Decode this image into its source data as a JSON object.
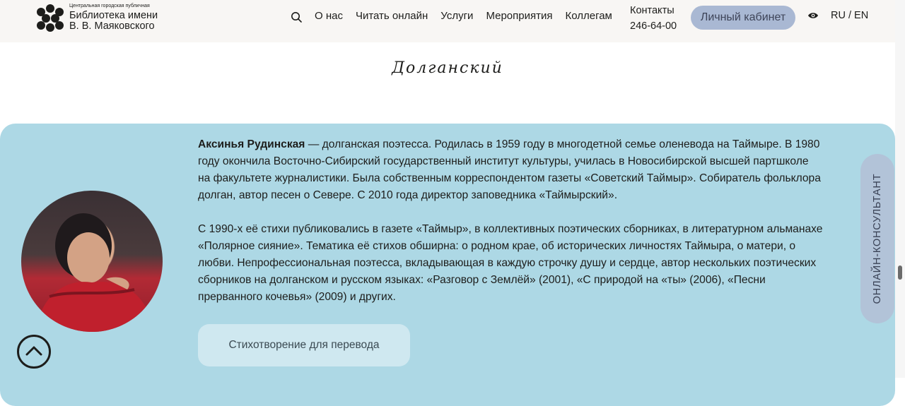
{
  "header": {
    "logo": {
      "small": "Центральная городская публичная",
      "line1": "Библиотека имени",
      "line2": "В. В. Маяковского"
    },
    "nav": [
      "О нас",
      "Читать онлайн",
      "Услуги",
      "Мероприятия",
      "Коллегам"
    ],
    "contacts_label": "Контакты",
    "contacts_phone": "246-64-00",
    "cabinet_label": "Личный кабинет",
    "lang_ru": "RU",
    "lang_sep": " / ",
    "lang_en": "EN"
  },
  "section_title": "Долганский",
  "bio": {
    "name": "Аксинья Рудинская",
    "p1_rest_line1": " — долганская поэтесса. Родилась в 1959 году в многодетной семье оленевода на Таймыре. В 1980",
    "p1_line2": "году окончила Восточно-Сибирский государственный институт культуры, училась в Новосибирской высшей партшколе",
    "p1_line3": "на факультете журналистики. Была собственным корреспондентом газеты «Советский Таймыр». Собиратель фольклора",
    "p1_line4": "долган, автор песен о Севере. С 2010 года директор заповедника «Таймырский».",
    "p2_line1": "С 1990-х её стихи публиковались в газете «Таймыр», в коллективных поэтических сборниках, в литературном альманахе",
    "p2_line2": "«Полярное сияние». Тематика её стихов обширна: о родном крае, об исторических личностях Таймыра, о матери, о",
    "p2_line3": "любви. Непрофессиональная поэтесса, вкладывающая в каждую строчку душу и сердце, автор нескольких поэтических",
    "p2_line4": "сборников на долганском и русском языках: «Разговор с Землёй» (2001), «С природой на «ты» (2006), «Песни",
    "p2_line5": "прерванного кочевья» (2009) и других."
  },
  "translate_button": "Стихотворение для перевода",
  "consultant_label": "ОНЛАЙН-КОНСУЛЬТАНТ",
  "colors": {
    "header_bg": "#f8f6f4",
    "card_bg": "#add8e5",
    "cabinet_bg": "#a9b8d3",
    "consultant_bg": "#b2c3d8"
  },
  "icons": [
    "logo-dots-icon",
    "search-icon",
    "eye-icon",
    "chevron-up-icon"
  ]
}
